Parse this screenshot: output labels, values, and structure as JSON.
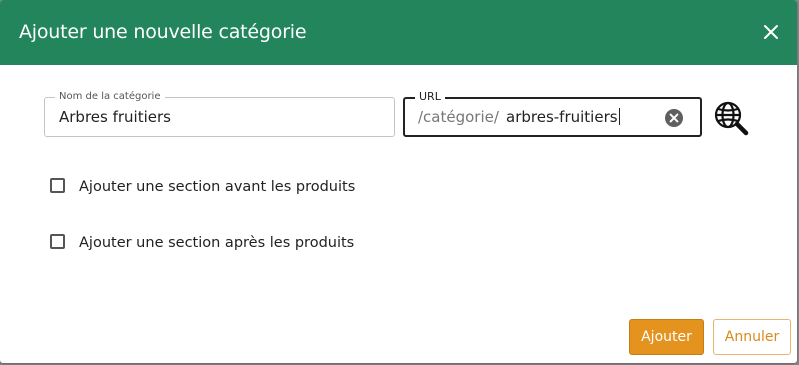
{
  "dialog": {
    "title": "Ajouter une nouvelle catégorie",
    "close_icon": "close-icon"
  },
  "form": {
    "name_field": {
      "label": "Nom de la catégorie",
      "value": "Arbres fruitiers"
    },
    "url_field": {
      "label": "URL",
      "prefix": "/catégorie/",
      "value": "arbres-fruitiers",
      "clear_icon": "clear-circle-icon"
    },
    "preview_icon": "globe-search-icon",
    "checkboxes": [
      {
        "label": "Ajouter une section avant les produits",
        "checked": false
      },
      {
        "label": "Ajouter une section après les produits",
        "checked": false
      }
    ]
  },
  "actions": {
    "confirm_label": "Ajouter",
    "cancel_label": "Annuler"
  },
  "colors": {
    "header": "#22855b",
    "primary_button": "#e5931f",
    "secondary_text": "#d98a1c"
  }
}
